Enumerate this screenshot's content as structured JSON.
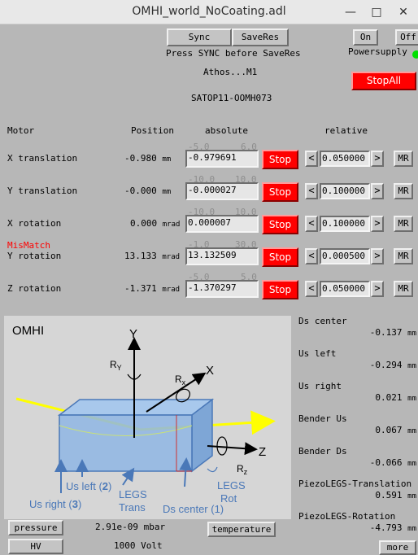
{
  "window": {
    "title": "OMHI_world_NoCoating.adl",
    "minimize_glyph": "—",
    "maximize_glyph": "□",
    "close_glyph": "✕"
  },
  "top": {
    "sync_label": "Sync",
    "saveres_label": "SaveRes",
    "note": "Press SYNC before SaveRes",
    "device": "Athos...M1",
    "pv": "SATOP11-OOMH073",
    "on_label": "On",
    "off_label": "Off",
    "powersupply_label": "Powersupply",
    "stopall_label": "StopAll"
  },
  "table": {
    "headers": {
      "motor": "Motor",
      "position": "Position",
      "absolute": "absolute",
      "relative": "relative"
    },
    "stop_label": "Stop",
    "mr_label": "MR",
    "left_arrow": "<",
    "right_arrow": ">",
    "rows": [
      {
        "name": "X translation",
        "position": "-0.980",
        "unit": "mm",
        "lim_low": "-5.0",
        "lim_high": "6.0",
        "absolute": "-0.979691",
        "relative": "0.050000",
        "mismatch": ""
      },
      {
        "name": "Y translation",
        "position": "-0.000",
        "unit": "mm",
        "lim_low": "-10.0",
        "lim_high": "10.0",
        "absolute": "-0.000027",
        "relative": "0.100000",
        "mismatch": ""
      },
      {
        "name": "X rotation",
        "position": "0.000",
        "unit": "mrad",
        "lim_low": "-10.0",
        "lim_high": "10.0",
        "absolute": "0.000007",
        "relative": "0.100000",
        "mismatch": ""
      },
      {
        "name": "Y rotation",
        "position": "13.133",
        "unit": "mrad",
        "lim_low": "-1.0",
        "lim_high": "30.0",
        "absolute": "13.132509",
        "relative": "0.000500",
        "mismatch": "MisMatch"
      },
      {
        "name": "Z rotation",
        "position": "-1.371",
        "unit": "mrad",
        "lim_low": "-5.0",
        "lim_high": "5.0",
        "absolute": "-1.370297",
        "relative": "0.050000",
        "mismatch": ""
      }
    ]
  },
  "diagram": {
    "title": "OMHI",
    "axis_y": "Y",
    "axis_x": "X",
    "axis_z": "Z",
    "rot_y": "R",
    "rot_y_sub": "Y",
    "rot_x": "R",
    "rot_x_sub": "x",
    "rot_z": "R",
    "rot_z_sub": "z",
    "us_left": "Us left (",
    "us_left_n": "2",
    "us_right": "Us right (",
    "us_right_n": "3",
    "legs_trans_1": "LEGS",
    "legs_trans_2": "Trans",
    "ds_center": "Ds center (1)",
    "legs_rot_1": "LEGS",
    "legs_rot_2": "Rot",
    "close_paren": ")"
  },
  "readbacks": [
    {
      "label": "Ds center",
      "value": "-0.137",
      "unit": "mm"
    },
    {
      "label": "Us left",
      "value": "-0.294",
      "unit": "mm"
    },
    {
      "label": "Us right",
      "value": "0.021",
      "unit": "mm"
    },
    {
      "label": "Bender Us",
      "value": "0.067",
      "unit": "mm"
    },
    {
      "label": "Bender Ds",
      "value": "-0.066",
      "unit": "mm"
    },
    {
      "label": "PiezoLEGS-Translation",
      "value": "0.591",
      "unit": "mm"
    },
    {
      "label": "PiezoLEGS-Rotation",
      "value": "-4.793",
      "unit": "mm"
    }
  ],
  "bottom": {
    "pressure_label": "pressure",
    "pressure_value": "2.91e-09 mbar",
    "temperature_label": "temperature",
    "hv_label": "HV",
    "hv_value": "1000 Volt",
    "more_label": "more"
  },
  "colors": {
    "stop": "#ff0000",
    "power_ok": "#00e000",
    "beam": "#ffff00"
  }
}
